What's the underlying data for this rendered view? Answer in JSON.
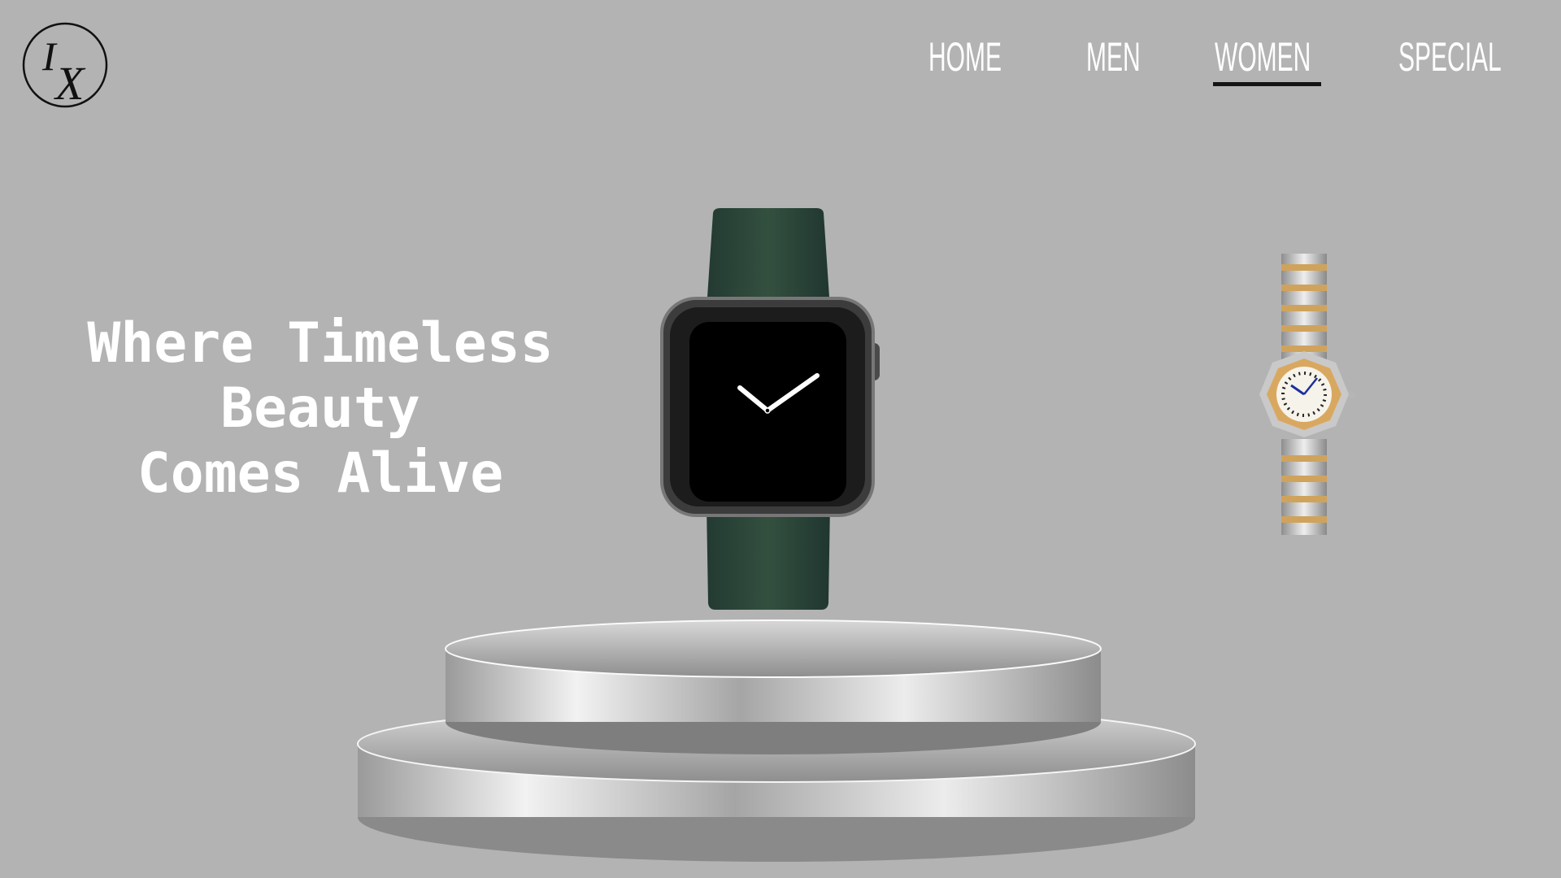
{
  "brand": {
    "monogram_top": "I",
    "monogram_bottom": "X"
  },
  "nav": {
    "items": [
      {
        "label": "HOME"
      },
      {
        "label": "MEN"
      },
      {
        "label": "WOMEN",
        "active": true
      },
      {
        "label": "SPECIAL"
      }
    ]
  },
  "hero": {
    "lines": [
      "Where Timeless",
      "Beauty",
      "Comes Alive"
    ]
  },
  "colors": {
    "background": "#b3b3b3",
    "nav_text": "#ffffff",
    "active_underline": "#141414",
    "watch_band": "#2e4a40",
    "watch_screen": "#000000",
    "podium": "#c9c9c9",
    "ladies_watch_gold": "#d9a860"
  },
  "icons": [
    "logo-monogram-icon",
    "smartwatch-image",
    "ladies-watch-image",
    "podium-image"
  ]
}
